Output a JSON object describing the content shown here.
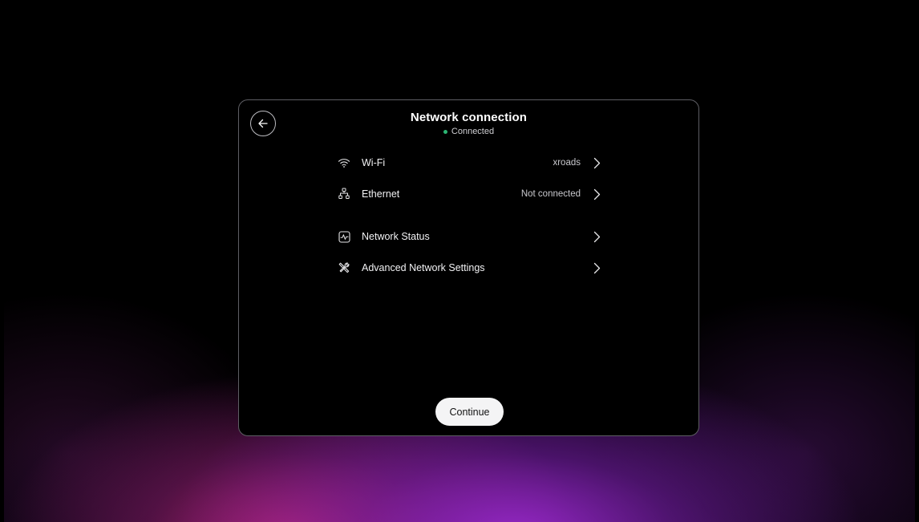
{
  "dialog": {
    "title": "Network connection",
    "status": {
      "text": "Connected",
      "color": "#2bb673"
    },
    "back_icon": "arrow-left-icon"
  },
  "rows": [
    {
      "icon": "wifi-icon",
      "label": "Wi-Fi",
      "value": "xroads"
    },
    {
      "icon": "ethernet-icon",
      "label": "Ethernet",
      "value": "Not connected"
    },
    {
      "icon": "network-status-icon",
      "label": "Network Status",
      "value": ""
    },
    {
      "icon": "tools-icon",
      "label": "Advanced Network Settings",
      "value": ""
    }
  ],
  "continue_label": "Continue"
}
